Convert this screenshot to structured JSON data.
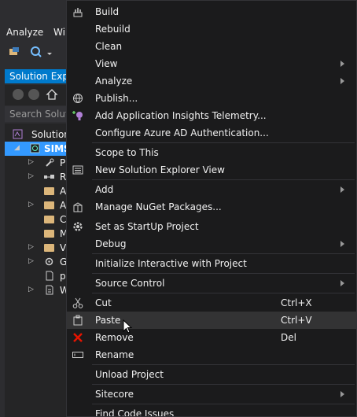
{
  "menubar": {
    "items": [
      "Analyze",
      "Wi"
    ]
  },
  "solution_explorer": {
    "title": "Solution Explo",
    "search_placeholder": "Search Solutio",
    "tree": [
      {
        "label": "Solution",
        "selected": false
      },
      {
        "label": "SIMS",
        "selected": true
      },
      {
        "label": "P",
        "selected": false
      },
      {
        "label": "R",
        "selected": false
      },
      {
        "label": "A",
        "selected": false
      },
      {
        "label": "A",
        "selected": false
      },
      {
        "label": "C",
        "selected": false
      },
      {
        "label": "M",
        "selected": false
      },
      {
        "label": "V",
        "selected": false
      },
      {
        "label": "G",
        "selected": false
      },
      {
        "label": "p",
        "selected": false
      },
      {
        "label": "W",
        "selected": false
      }
    ]
  },
  "context_menu": {
    "items": [
      {
        "label": "Build",
        "icon": "build-icon"
      },
      {
        "label": "Rebuild"
      },
      {
        "label": "Clean"
      },
      {
        "label": "View",
        "submenu": true
      },
      {
        "label": "Analyze",
        "submenu": true
      },
      {
        "label": "Publish...",
        "icon": "publish-icon"
      },
      {
        "label": "Add Application Insights Telemetry...",
        "icon": "insights-icon"
      },
      {
        "label": "Configure Azure AD Authentication..."
      },
      {
        "label": "Scope to This"
      },
      {
        "label": "New Solution Explorer View",
        "icon": "new-view-icon"
      },
      {
        "label": "Add",
        "submenu": true
      },
      {
        "label": "Manage NuGet Packages...",
        "icon": "nuget-icon"
      },
      {
        "label": "Set as StartUp Project",
        "icon": "gear-icon"
      },
      {
        "label": "Debug",
        "submenu": true
      },
      {
        "label": "Initialize Interactive with Project"
      },
      {
        "label": "Source Control",
        "submenu": true
      },
      {
        "label": "Cut",
        "shortcut": "Ctrl+X",
        "icon": "scissors-icon"
      },
      {
        "label": "Paste",
        "shortcut": "Ctrl+V",
        "icon": "clipboard-icon",
        "hover": true
      },
      {
        "label": "Remove",
        "shortcut": "Del",
        "icon": "remove-icon"
      },
      {
        "label": "Rename",
        "icon": "rename-icon"
      },
      {
        "label": "Unload Project"
      },
      {
        "label": "Sitecore",
        "submenu": true
      },
      {
        "label": "Find Code Issues"
      }
    ]
  },
  "colors": {
    "accent": "#007acc",
    "selection": "#3399ff",
    "menu_bg": "#1b1b1c",
    "hover": "#333334",
    "remove_icon": "#e51400"
  }
}
